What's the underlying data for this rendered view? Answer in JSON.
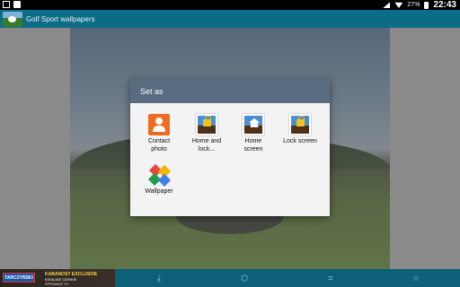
{
  "status_bar": {
    "battery_percent": "27%",
    "time": "22:43",
    "icons": [
      "notification-icon",
      "image-icon",
      "mute-icon",
      "wifi-icon",
      "battery-icon"
    ]
  },
  "action_bar": {
    "title": "Golf Sport wallpapers"
  },
  "dialog": {
    "title": "Set as",
    "items": [
      {
        "label_l1": "Contact",
        "label_l2": "photo",
        "icon": "contact-icon"
      },
      {
        "label_l1": "Home and",
        "label_l2": "lock...",
        "icon": "home-lock-icon"
      },
      {
        "label_l1": "Home",
        "label_l2": "screen",
        "icon": "home-screen-icon"
      },
      {
        "label_l1": "Lock screen",
        "label_l2": "",
        "icon": "lock-screen-icon"
      },
      {
        "label_l1": "Wallpaper",
        "label_l2": "",
        "icon": "wallpaper-icon"
      }
    ]
  },
  "ad": {
    "logo": "TARCZYŃSKI",
    "line1": "KABANOSY EXCLUSIVE",
    "line2": "IDEALNIE CIENKIE",
    "line3": "SPRAWDŹ TO"
  },
  "bottom_bar": {
    "buttons": [
      "download-icon",
      "share-icon",
      "crop-icon",
      "favorite-icon"
    ]
  }
}
